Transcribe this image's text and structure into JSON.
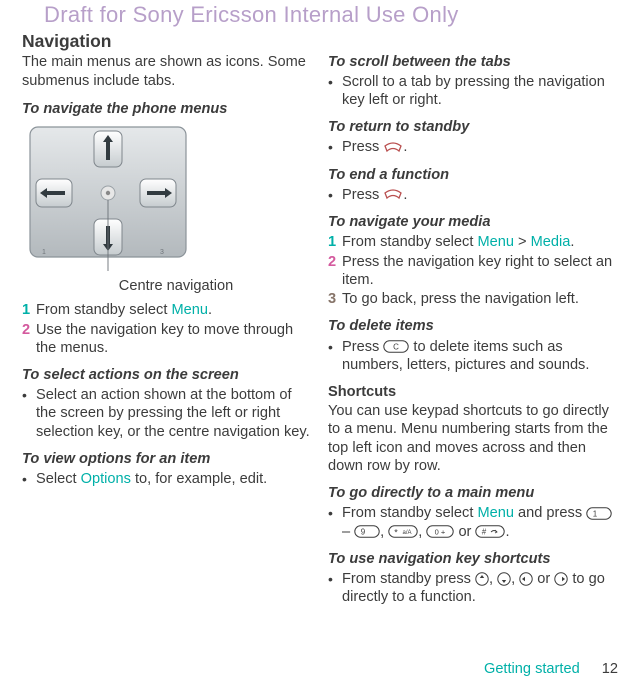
{
  "draft_notice": "Draft for Sony Ericsson Internal Use Only",
  "left": {
    "title": "Navigation",
    "intro": "The main menus are shown as icons. Some submenus include tabs.",
    "h_navigate_menus": "To navigate the phone menus",
    "caption": "Centre navigation",
    "step1_num": "1",
    "step1_text_a": "From standby select ",
    "step1_menu": "Menu",
    "step1_text_b": ".",
    "step2_num": "2",
    "step2_text": "Use the navigation key to move through the menus.",
    "h_select_actions": "To select actions on the screen",
    "select_actions_text": "Select an action shown at the bottom of the screen by pressing the left or right selection key, or the centre navigation key.",
    "h_view_options": "To view options for an item",
    "view_options_a": "Select ",
    "view_options_link": "Options",
    "view_options_b": " to, for example, edit."
  },
  "right": {
    "h_scroll_tabs": "To scroll between the tabs",
    "scroll_tabs_text": "Scroll to a tab by pressing the navigation key left or right.",
    "h_return_standby": "To return to standby",
    "return_standby_text_a": "Press ",
    "return_standby_text_b": ".",
    "h_end_function": "To end a function",
    "end_function_text_a": "Press ",
    "end_function_text_b": ".",
    "h_navigate_media": "To navigate your media",
    "media_step1_num": "1",
    "media_step1_a": "From standby select ",
    "media_step1_menu": "Menu",
    "media_step1_gt": " > ",
    "media_step1_media": "Media",
    "media_step1_b": ".",
    "media_step2_num": "2",
    "media_step2_text": "Press the navigation key right to select an item.",
    "media_step3_num": "3",
    "media_step3_text": "To go back, press the navigation left.",
    "h_delete_items": "To delete items",
    "delete_items_a": "Press ",
    "delete_items_b": " to delete items such as numbers, letters, pictures and sounds.",
    "h_shortcuts": "Shortcuts",
    "shortcuts_text": "You can use keypad shortcuts to go directly to a menu. Menu numbering starts from the top left icon and moves across and then down row by row.",
    "h_go_directly_menu": "To go directly to a main menu",
    "go_menu_a": "From standby select ",
    "go_menu_menu": "Menu",
    "go_menu_b": " and press ",
    "go_menu_c": " – ",
    "go_menu_d": ", ",
    "go_menu_e": ", ",
    "go_menu_f": " or ",
    "go_menu_g": ".",
    "key_1": "1",
    "key_9": "9",
    "key_star": "a/A",
    "key_0": "0 +",
    "key_hash": "#",
    "h_nav_key_shortcuts": "To use navigation key shortcuts",
    "nav_shortcuts_a": "From standby press ",
    "nav_shortcuts_b": ", ",
    "nav_shortcuts_c": ", ",
    "nav_shortcuts_d": " or ",
    "nav_shortcuts_e": " to go directly to a function."
  },
  "footer": {
    "label": "Getting started",
    "page": "12"
  }
}
